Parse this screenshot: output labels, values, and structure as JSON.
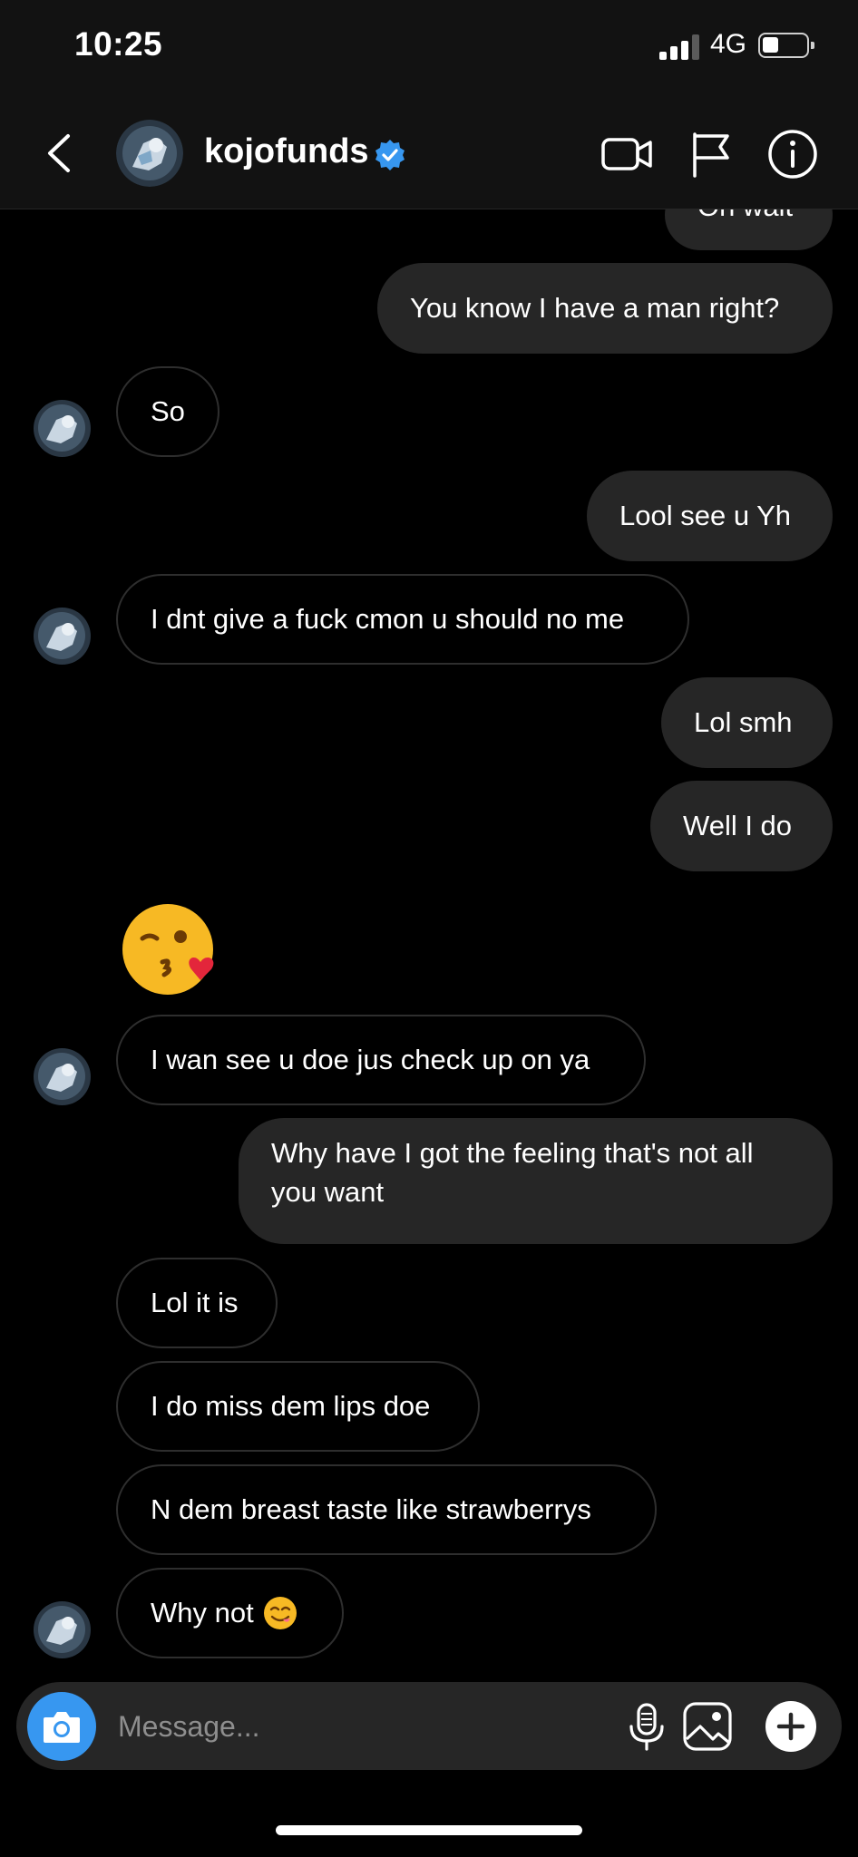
{
  "status_bar": {
    "time": "10:25",
    "network": "4G"
  },
  "header": {
    "username": "kojofunds",
    "verified": true
  },
  "icons": {
    "back": "chevron-left-icon",
    "video": "video-camera-icon",
    "report": "flag-icon",
    "info": "info-icon",
    "camera": "camera-icon",
    "mic": "microphone-icon",
    "gallery": "image-icon",
    "add": "plus-icon"
  },
  "messages": [
    {
      "side": "out",
      "text": "Oh wait"
    },
    {
      "side": "out",
      "text": "You know I have a man right?"
    },
    {
      "side": "in",
      "text": "So"
    },
    {
      "side": "out",
      "text": "Lool see u Yh"
    },
    {
      "side": "in",
      "text": "I dnt give a fuck cmon u should no me"
    },
    {
      "side": "out",
      "text": "Lol smh"
    },
    {
      "side": "out",
      "text": "Well I do"
    },
    {
      "side": "in",
      "text": "😘",
      "emoji_name": "kissing-face-with-heart"
    },
    {
      "side": "in",
      "text": "I wan see u doe jus check up on ya"
    },
    {
      "side": "out",
      "text": "Why have I got the feeling that's not all you want"
    },
    {
      "side": "in",
      "text": "Lol it is"
    },
    {
      "side": "in",
      "text": "I do miss dem lips doe"
    },
    {
      "side": "in",
      "text": "N dem breast taste like strawberrys"
    },
    {
      "side": "in",
      "text": "Why not",
      "emoji_name": "face-savoring-food"
    }
  ],
  "composer": {
    "placeholder": "Message..."
  },
  "colors": {
    "accent": "#3797f0",
    "bubble_out": "#262626",
    "bubble_in_border": "#2e2e2e",
    "verified": "#3797f0"
  }
}
